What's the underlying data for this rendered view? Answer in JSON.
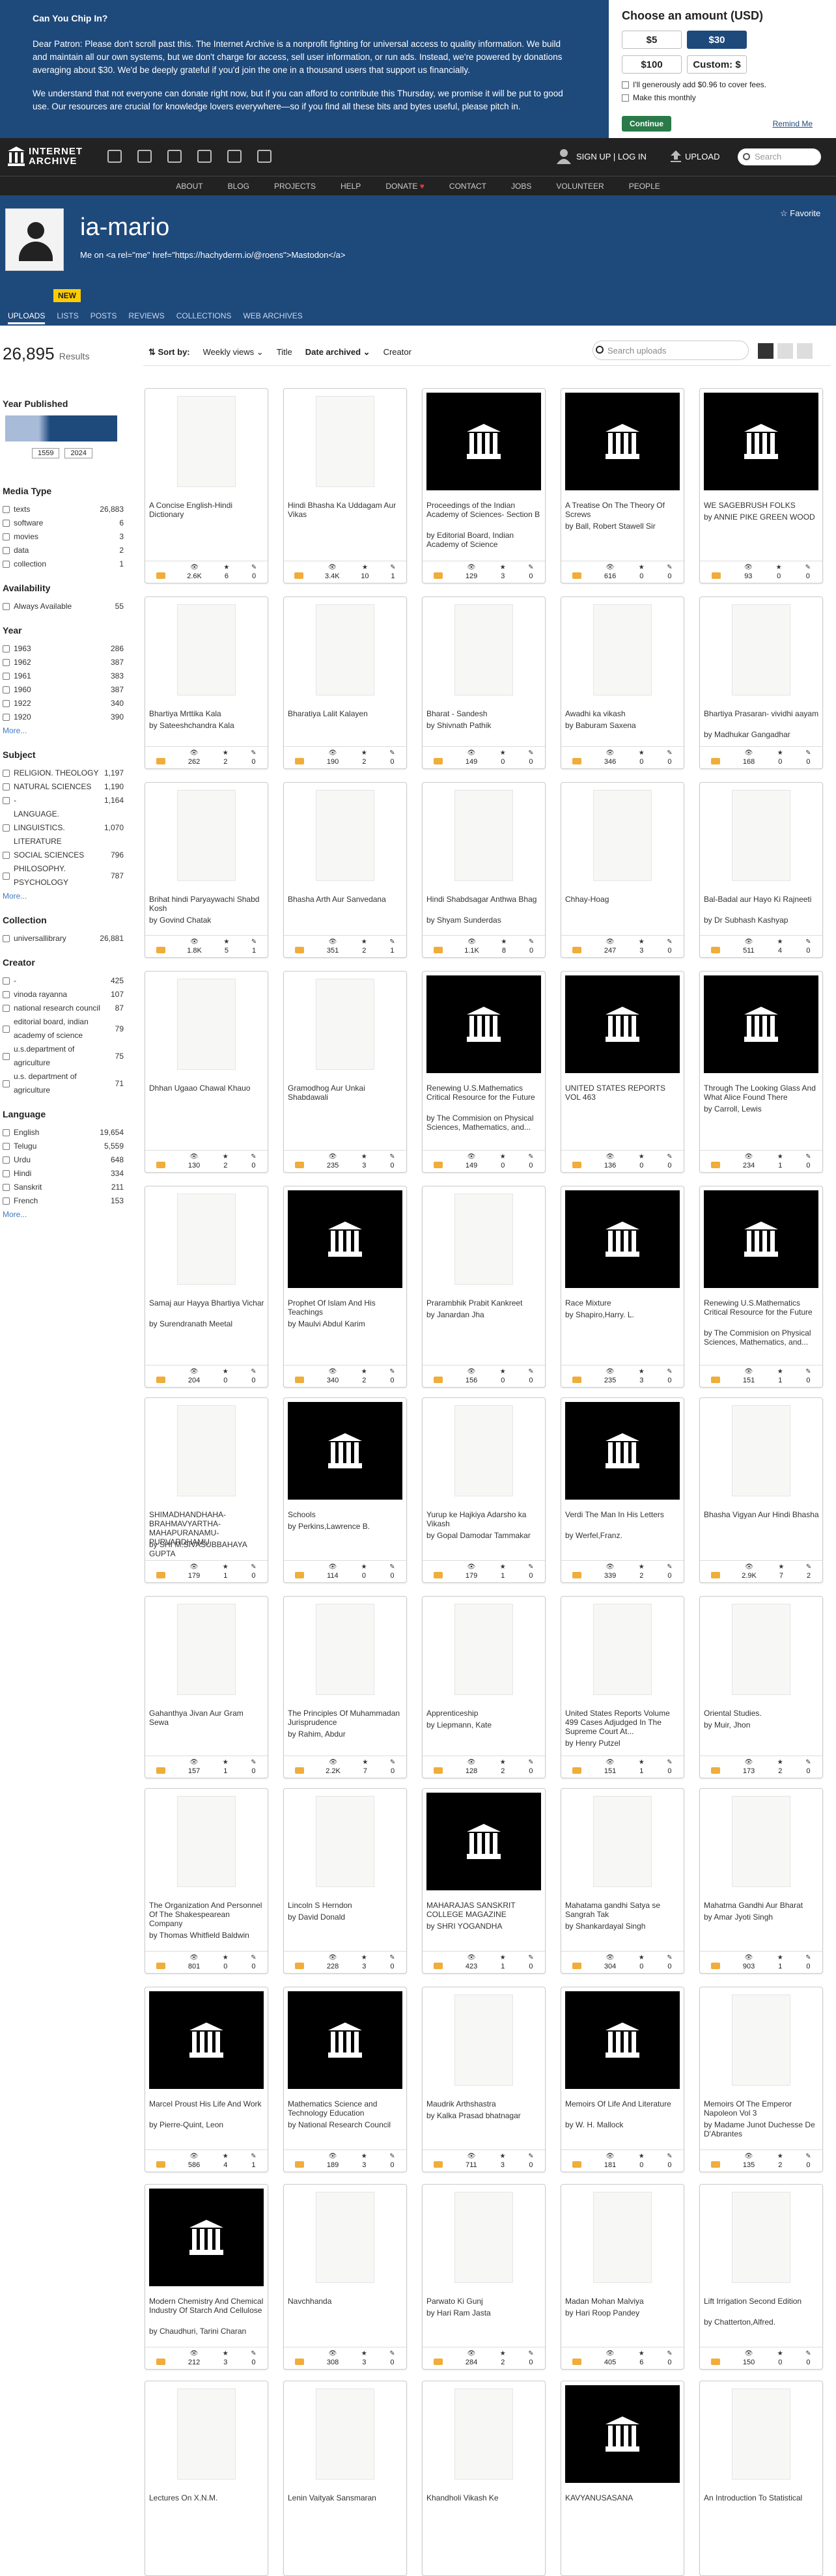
{
  "donate": {
    "heading": "Can You Chip In?",
    "p1": "Dear Patron: Please don't scroll past this. The Internet Archive is a nonprofit fighting for universal access to quality information. We build and maintain all our own systems, but we don't charge for access, sell user information, or run ads. Instead, we're powered by donations averaging about $30. We'd be deeply grateful if you'd join the one in a thousand users that support us financially.",
    "p2": "We understand that not everyone can donate right now, but if you can afford to contribute this Thursday, we promise it will be put to good use. Our resources are crucial for knowledge lovers everywhere—so if you find all these bits and bytes useful, please pitch in.",
    "box_title": "Choose an amount (USD)",
    "amounts": [
      "$5",
      "$30",
      "$100",
      "Custom: $"
    ],
    "fee_label": "I'll generously add $0.96 to cover fees.",
    "monthly_label": "Make this monthly",
    "continue": "Continue",
    "remind": "Remind Me"
  },
  "nav": {
    "logo": "INTERNET ARCHIVE",
    "signup": "SIGN UP | LOG IN",
    "upload": "UPLOAD",
    "search_placeholder": "Search",
    "links": [
      "ABOUT",
      "BLOG",
      "PROJECTS",
      "HELP",
      "DONATE",
      "CONTACT",
      "JOBS",
      "VOLUNTEER",
      "PEOPLE"
    ]
  },
  "account": {
    "name": "ia-mario",
    "desc": "Me on <a rel=\"me\" href=\"https://hachyderm.io/@roens\">Mastodon</a>",
    "favorite": "Favorite",
    "badge": "NEW",
    "tabs": [
      "UPLOADS",
      "LISTS",
      "POSTS",
      "REVIEWS",
      "COLLECTIONS",
      "WEB ARCHIVES"
    ]
  },
  "results": {
    "count": "26,895",
    "label": "Results"
  },
  "sort": {
    "label": "Sort by:",
    "options": [
      "Weekly views",
      "Title",
      "Date archived",
      "Creator"
    ],
    "search_placeholder": "Search uploads"
  },
  "sidebar": {
    "year_published": "Year Published",
    "year_from": "1559",
    "year_to": "2024",
    "facets": [
      {
        "title": "Media Type",
        "items": [
          [
            "texts",
            "26,883"
          ],
          [
            "software",
            "6"
          ],
          [
            "movies",
            "3"
          ],
          [
            "data",
            "2"
          ],
          [
            "collection",
            "1"
          ]
        ]
      },
      {
        "title": "Availability",
        "items": [
          [
            "Always Available",
            "55"
          ]
        ]
      },
      {
        "title": "Year",
        "items": [
          [
            "1963",
            "286"
          ],
          [
            "1962",
            "387"
          ],
          [
            "1961",
            "383"
          ],
          [
            "1960",
            "387"
          ],
          [
            "1922",
            "340"
          ],
          [
            "1920",
            "390"
          ]
        ],
        "more": "More..."
      },
      {
        "title": "Subject",
        "items": [
          [
            "RELIGION. THEOLOGY",
            "1,197"
          ],
          [
            "NATURAL SCIENCES",
            "1,190"
          ],
          [
            "-",
            "1,164"
          ],
          [
            "LANGUAGE. LINGUISTICS. LITERATURE",
            "1,070"
          ],
          [
            "SOCIAL SCIENCES",
            "796"
          ],
          [
            "PHILOSOPHY. PSYCHOLOGY",
            "787"
          ]
        ],
        "more": "More..."
      },
      {
        "title": "Collection",
        "items": [
          [
            "universallibrary",
            "26,881"
          ]
        ]
      },
      {
        "title": "Creator",
        "items": [
          [
            "-",
            "425"
          ],
          [
            "vinoda rayanna",
            "107"
          ],
          [
            "national research council",
            "87"
          ],
          [
            "editorial board, indian academy of science",
            "79"
          ],
          [
            "u.s.department of agriculture",
            "75"
          ],
          [
            "u.s. department of agriculture",
            "71"
          ]
        ]
      },
      {
        "title": "Language",
        "items": [
          [
            "English",
            "19,654"
          ],
          [
            "Telugu",
            "5,559"
          ],
          [
            "Urdu",
            "648"
          ],
          [
            "Hindi",
            "334"
          ],
          [
            "Sanskrit",
            "211"
          ],
          [
            "French",
            "153"
          ]
        ],
        "more": "More..."
      }
    ]
  },
  "items": [
    {
      "t": "A Concise English-Hindi Dictionary",
      "by": "",
      "v": "2.6K",
      "f": "6",
      "r": "0",
      "th": "scan"
    },
    {
      "t": "Hindi Bhasha Ka Uddagam Aur Vikas",
      "by": "",
      "v": "3.4K",
      "f": "10",
      "r": "1",
      "th": "scan"
    },
    {
      "t": "Proceedings of the Indian Academy of Sciences- Section B",
      "by": "by Editorial Board, Indian Academy of Science",
      "v": "129",
      "f": "3",
      "r": "0",
      "th": "icon"
    },
    {
      "t": "A Treatise On The Theory Of Screws",
      "by": "by Ball, Robert Stawell Sir",
      "v": "616",
      "f": "0",
      "r": "0",
      "th": "icon"
    },
    {
      "t": "WE SAGEBRUSH FOLKS",
      "by": "by ANNIE PIKE GREEN WOOD",
      "v": "93",
      "f": "0",
      "r": "0",
      "th": "icon"
    },
    {
      "t": "Bhartiya Mrttika Kala",
      "by": "by Sateeshchandra Kala",
      "v": "262",
      "f": "2",
      "r": "0",
      "th": "scan"
    },
    {
      "t": "Bharatiya Lalit Kalayen",
      "by": "",
      "v": "190",
      "f": "2",
      "r": "0",
      "th": "scan"
    },
    {
      "t": "Bharat - Sandesh",
      "by": "by Shivnath Pathik",
      "v": "149",
      "f": "0",
      "r": "0",
      "th": "scan"
    },
    {
      "t": "Awadhi ka vikash",
      "by": "by Baburam Saxena",
      "v": "346",
      "f": "0",
      "r": "0",
      "th": "scan"
    },
    {
      "t": "Bhartiya Prasaran- vividhi aayam",
      "by": "by Madhukar Gangadhar",
      "v": "168",
      "f": "0",
      "r": "0",
      "th": "scan"
    },
    {
      "t": "Brihat hindi Paryaywachi Shabd Kosh",
      "by": "by Govind Chatak",
      "v": "1.8K",
      "f": "5",
      "r": "1",
      "th": "scan"
    },
    {
      "t": "Bhasha Arth Aur Sanvedana",
      "by": "",
      "v": "351",
      "f": "2",
      "r": "1",
      "th": "scan"
    },
    {
      "t": "Hindi Shabdsagar Anthwa Bhag",
      "by": "by Shyam Sunderdas",
      "v": "1.1K",
      "f": "8",
      "r": "0",
      "th": "scan"
    },
    {
      "t": "Chhay-Hoag",
      "by": "",
      "v": "247",
      "f": "3",
      "r": "0",
      "th": "scan"
    },
    {
      "t": "Bal-Badal aur Hayo Ki Rajneeti",
      "by": "by Dr Subhash Kashyap",
      "v": "511",
      "f": "4",
      "r": "0",
      "th": "scan"
    },
    {
      "t": "Dhhan Ugaao Chawal Khauo",
      "by": "",
      "v": "130",
      "f": "2",
      "r": "0",
      "th": "scan"
    },
    {
      "t": "Gramodhog Aur Unkai Shabdawali",
      "by": "",
      "v": "235",
      "f": "3",
      "r": "0",
      "th": "scan"
    },
    {
      "t": "Renewing U.S.Mathematics Critical Resource for the Future",
      "by": "by The Commision on Physical Sciences, Mathematics, and...",
      "v": "149",
      "f": "0",
      "r": "0",
      "th": "icon"
    },
    {
      "t": "UNITED STATES REPORTS VOL 463",
      "by": "",
      "v": "136",
      "f": "0",
      "r": "0",
      "th": "icon"
    },
    {
      "t": "Through The Looking Glass And What Alice Found There",
      "by": "by Carroll, Lewis",
      "v": "234",
      "f": "1",
      "r": "0",
      "th": "icon"
    },
    {
      "t": "Samaj aur Hayya Bhartiya Vichar",
      "by": "by Surendranath Meetal",
      "v": "204",
      "f": "0",
      "r": "0",
      "th": "scan"
    },
    {
      "t": "Prophet Of Islam And His Teachings",
      "by": "by Maulvi Abdul Karim",
      "v": "340",
      "f": "2",
      "r": "0",
      "th": "icon"
    },
    {
      "t": "Prarambhik Prabit Kankreet",
      "by": "by Janardan Jha",
      "v": "156",
      "f": "0",
      "r": "0",
      "th": "scan"
    },
    {
      "t": "Race Mixture",
      "by": "by Shapiro,Harry. L.",
      "v": "235",
      "f": "3",
      "r": "0",
      "th": "icon"
    },
    {
      "t": "Renewing U.S.Mathematics Critical Resource for the Future",
      "by": "by The Commision on Physical Sciences, Mathematics, and...",
      "v": "151",
      "f": "1",
      "r": "0",
      "th": "icon"
    },
    {
      "t": "SHIMADHANDHAHA-BRAHMAVYARTHA-MAHAPURANAMU-PURVARDHAMU",
      "by": "by SHI M.SIVASUBBAHAYA GUPTA",
      "v": "179",
      "f": "1",
      "r": "0",
      "th": "scan"
    },
    {
      "t": "Schools",
      "by": "by Perkins,Lawrence B.",
      "v": "114",
      "f": "0",
      "r": "0",
      "th": "icon"
    },
    {
      "t": "Yurup ke Hajkiya Adarsho ka Vikash",
      "by": "by Gopal Damodar Tammakar",
      "v": "179",
      "f": "1",
      "r": "0",
      "th": "scan"
    },
    {
      "t": "Verdi The Man In His Letters",
      "by": "by Werfel,Franz.",
      "v": "339",
      "f": "2",
      "r": "0",
      "th": "icon"
    },
    {
      "t": "Bhasha Vigyan Aur Hindi Bhasha",
      "by": "",
      "v": "2.9K",
      "f": "7",
      "r": "2",
      "th": "scan"
    },
    {
      "t": "Gahanthya Jivan Aur Gram Sewa",
      "by": "",
      "v": "157",
      "f": "1",
      "r": "0",
      "th": "scan"
    },
    {
      "t": "The Principles Of Muhammadan Jurisprudence",
      "by": "by Rahim, Abdur",
      "v": "2.2K",
      "f": "7",
      "r": "0",
      "th": "scan"
    },
    {
      "t": "Apprenticeship",
      "by": "by Liepmann, Kate",
      "v": "128",
      "f": "2",
      "r": "0",
      "th": "scan"
    },
    {
      "t": "United States Reports Volume 499 Cases Adjudged In The Supreme Court At...",
      "by": "by Henry Putzel",
      "v": "151",
      "f": "1",
      "r": "0",
      "th": "scan"
    },
    {
      "t": "Oriental Studies.",
      "by": "by Muir, Jhon",
      "v": "173",
      "f": "2",
      "r": "0",
      "th": "scan"
    },
    {
      "t": "The Organization And Personnel Of The Shakespearean Company",
      "by": "by Thomas Whitfield Baldwin",
      "v": "801",
      "f": "0",
      "r": "0",
      "th": "scan"
    },
    {
      "t": "Lincoln S Herndon",
      "by": "by David Donald",
      "v": "228",
      "f": "3",
      "r": "0",
      "th": "scan"
    },
    {
      "t": "MAHARAJAS SANSKRIT COLLEGE MAGAZINE",
      "by": "by SHRI YOGANDHA",
      "v": "423",
      "f": "1",
      "r": "0",
      "th": "icon"
    },
    {
      "t": "Mahatama gandhi Satya se Sangrah Tak",
      "by": "by Shankardayal Singh",
      "v": "304",
      "f": "0",
      "r": "0",
      "th": "scan"
    },
    {
      "t": "Mahatma Gandhi Aur Bharat",
      "by": "by Amar Jyoti Singh",
      "v": "903",
      "f": "1",
      "r": "0",
      "th": "scan"
    },
    {
      "t": "Marcel Proust His Life And Work",
      "by": "by Pierre-Quint, Leon",
      "v": "586",
      "f": "4",
      "r": "1",
      "th": "icon"
    },
    {
      "t": "Mathematics Science and Technology Education",
      "by": "by National Research Council",
      "v": "189",
      "f": "3",
      "r": "0",
      "th": "icon"
    },
    {
      "t": "Maudrik Arthshastra",
      "by": "by Kalka Prasad bhatnagar",
      "v": "711",
      "f": "3",
      "r": "0",
      "th": "scan"
    },
    {
      "t": "Memoirs Of Life And Literature",
      "by": "by W. H. Mallock",
      "v": "181",
      "f": "0",
      "r": "0",
      "th": "icon"
    },
    {
      "t": "Memoirs Of The Emperor Napoleon Vol 3",
      "by": "by Madame Junot Duchesse De D'Abrantes",
      "v": "135",
      "f": "2",
      "r": "0",
      "th": "scan"
    },
    {
      "t": "Modern Chemistry And Chemical Industry Of Starch And Cellulose",
      "by": "by Chaudhuri, Tarini Charan",
      "v": "212",
      "f": "3",
      "r": "0",
      "th": "icon"
    },
    {
      "t": "Navchhanda",
      "by": "",
      "v": "308",
      "f": "3",
      "r": "0",
      "th": "scan"
    },
    {
      "t": "Parwato Ki Gunj",
      "by": "by Hari Ram Jasta",
      "v": "284",
      "f": "2",
      "r": "0",
      "th": "scan"
    },
    {
      "t": "Madan Mohan Malviya",
      "by": "by Hari Roop Pandey",
      "v": "405",
      "f": "6",
      "r": "0",
      "th": "scan"
    },
    {
      "t": "Lift Irrigation Second Edition",
      "by": "by Chatterton,Alfred.",
      "v": "150",
      "f": "0",
      "r": "0",
      "th": "scan"
    },
    {
      "t": "Lectures On X.N.M.",
      "by": "",
      "v": "",
      "f": "",
      "r": "",
      "th": "scan"
    },
    {
      "t": "Lenin Vaityak Sansmaran",
      "by": "",
      "v": "",
      "f": "",
      "r": "",
      "th": "scan"
    },
    {
      "t": "Khandholi Vikash Ke",
      "by": "",
      "v": "",
      "f": "",
      "r": "",
      "th": "scan"
    },
    {
      "t": "KAVYANUSASANA",
      "by": "",
      "v": "",
      "f": "",
      "r": "",
      "th": "icon"
    },
    {
      "t": "An Introduction To Statistical",
      "by": "",
      "v": "",
      "f": "",
      "r": "",
      "th": "scan"
    }
  ]
}
